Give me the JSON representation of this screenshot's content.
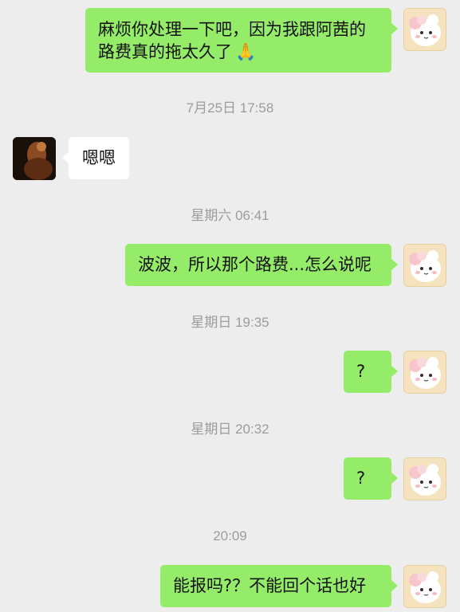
{
  "messages": [
    {
      "sender": "me",
      "text_line1": "麻烦你处理一下吧，因为我跟阿茜的",
      "text_line2": "路费真的拖太久了",
      "emoji": "🙏"
    },
    {
      "timestamp": "7月25日 17:58"
    },
    {
      "sender": "other",
      "text": "嗯嗯"
    },
    {
      "timestamp": "星期六 06:41"
    },
    {
      "sender": "me",
      "text": "波波，所以那个路费...怎么说呢"
    },
    {
      "timestamp": "星期日 19:35"
    },
    {
      "sender": "me",
      "text": "?"
    },
    {
      "timestamp": "星期日 20:32"
    },
    {
      "sender": "me",
      "text": "?"
    },
    {
      "timestamp": "20:09"
    },
    {
      "sender": "me",
      "text": "能报吗?？不能回个话也好"
    }
  ],
  "colors": {
    "background": "#ededed",
    "my_bubble": "#95ec69",
    "other_bubble": "#ffffff",
    "timestamp_text": "#9c9c9c"
  },
  "icons": {
    "my_avatar": "cute-cartoon-sheep-avatar",
    "other_avatar": "dark-photo-avatar",
    "emoji": "folded-hands-emoji"
  }
}
